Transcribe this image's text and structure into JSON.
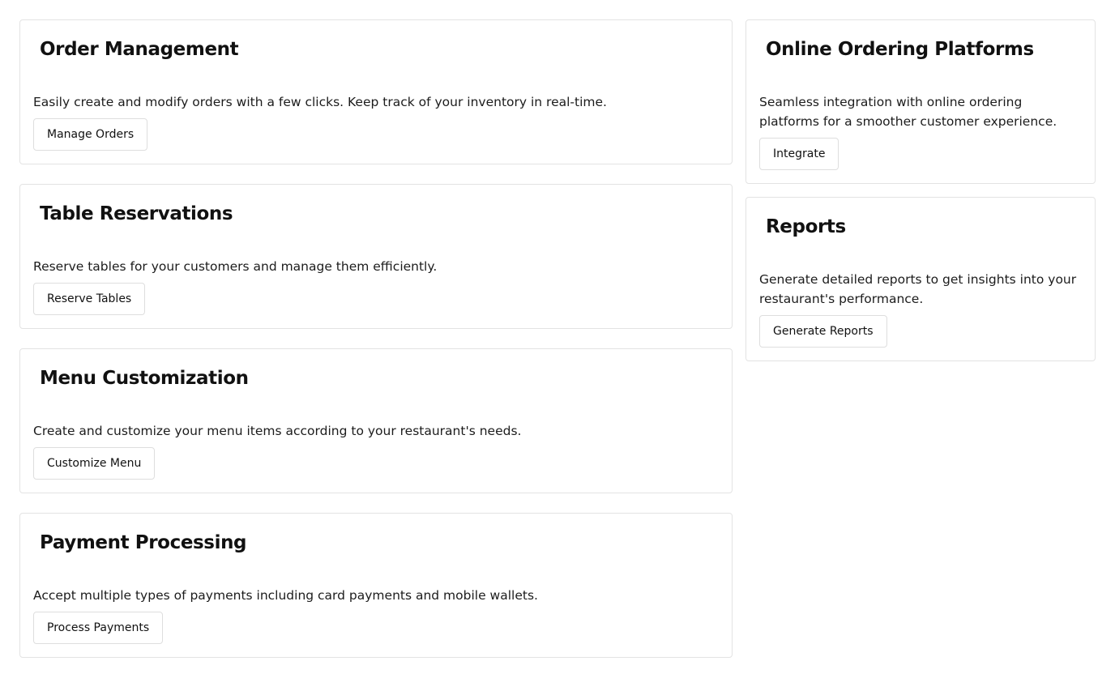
{
  "left_cards": [
    {
      "title": "Order Management",
      "description": "Easily create and modify orders with a few clicks. Keep track of your inventory in real-time.",
      "button": "Manage Orders"
    },
    {
      "title": "Table Reservations",
      "description": "Reserve tables for your customers and manage them efficiently.",
      "button": "Reserve Tables"
    },
    {
      "title": "Menu Customization",
      "description": "Create and customize your menu items according to your restaurant's needs.",
      "button": "Customize Menu"
    },
    {
      "title": "Payment Processing",
      "description": "Accept multiple types of payments including card payments and mobile wallets.",
      "button": "Process Payments"
    }
  ],
  "right_cards": [
    {
      "title": "Online Ordering Platforms",
      "description": "Seamless integration with online ordering platforms for a smoother customer experience.",
      "button": "Integrate"
    },
    {
      "title": "Reports",
      "description": "Generate detailed reports to get insights into your restaurant's performance.",
      "button": "Generate Reports"
    }
  ]
}
